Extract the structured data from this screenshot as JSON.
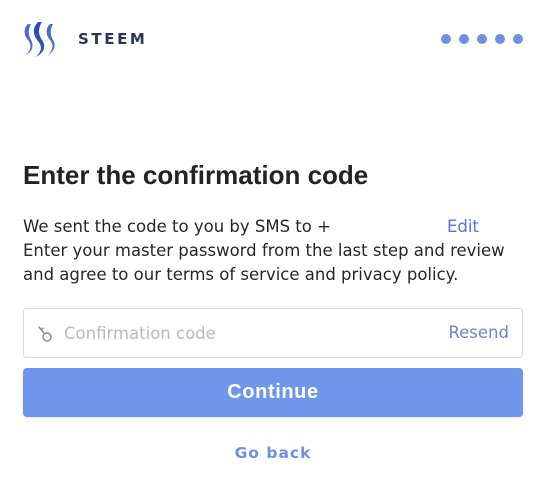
{
  "header": {
    "brand": "STEEM",
    "logo_icon": "steem-logo-icon",
    "progress_dots": 5
  },
  "title": "Enter the confirmation code",
  "description": {
    "sms_text": "We sent the code to you by SMS to +",
    "edit_label": "Edit",
    "line2": "Enter your master password from the last step and review",
    "line3": "and agree to our terms of service and privacy policy."
  },
  "confirmation_field": {
    "icon": "key-icon",
    "value": "",
    "placeholder": "Confirmation code",
    "resend_label": "Resend"
  },
  "continue_label": "Continue",
  "go_back_label": "Go back",
  "colors": {
    "accent": "#7096ec",
    "link": "#5574d6",
    "brand_text": "#2a3552"
  }
}
